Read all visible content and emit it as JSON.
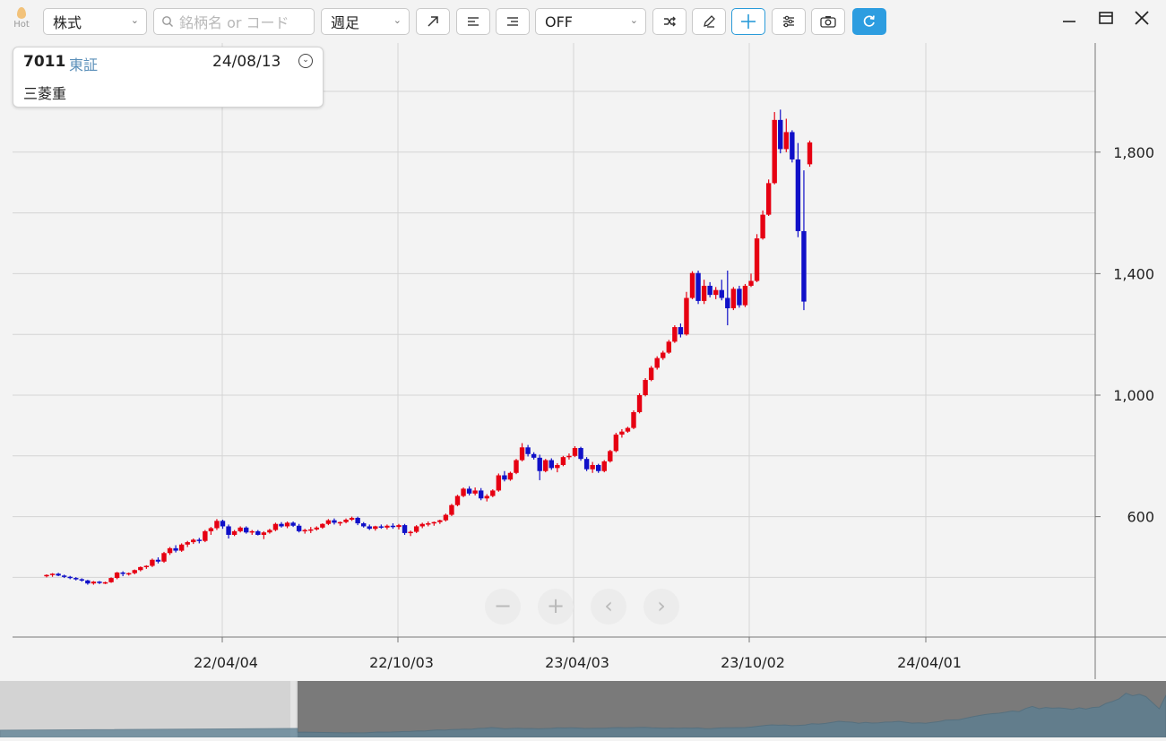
{
  "toolbar": {
    "hot_label": "Hot",
    "market_select": "株式",
    "search_placeholder": "銘柄名 or コード",
    "period_select": "週足",
    "indicator_select": "OFF"
  },
  "info_card": {
    "code": "7011",
    "exchange": "東証",
    "date": "24/08/13",
    "name": "三菱重"
  },
  "colors": {
    "up": "#e60012",
    "down": "#1010c8",
    "grid": "#d4d4d4",
    "accent": "#2d9de0"
  },
  "chart_data": {
    "type": "candlestick",
    "x_tick_labels": [
      "22/04/04",
      "22/10/03",
      "23/04/03",
      "23/10/02",
      "24/04/01"
    ],
    "y_tick_labels": [
      "600",
      "1,000",
      "1,400",
      "1,800"
    ],
    "y_ticks": [
      600,
      1000,
      1400,
      1800
    ],
    "ylim": [
      200,
      2000
    ],
    "grid": true,
    "x_axis_origin": "2021-11-08",
    "candles": [
      [
        0,
        404,
        410,
        400,
        408
      ],
      [
        1,
        408,
        414,
        402,
        412
      ],
      [
        2,
        412,
        415,
        404,
        406
      ],
      [
        3,
        406,
        409,
        398,
        402
      ],
      [
        4,
        402,
        405,
        394,
        398
      ],
      [
        5,
        398,
        401,
        390,
        394
      ],
      [
        6,
        394,
        397,
        386,
        390
      ],
      [
        7,
        390,
        392,
        376,
        380
      ],
      [
        8,
        380,
        388,
        376,
        386
      ],
      [
        9,
        386,
        388,
        378,
        382
      ],
      [
        10,
        382,
        386,
        378,
        384
      ],
      [
        11,
        384,
        400,
        382,
        398
      ],
      [
        12,
        398,
        418,
        394,
        416
      ],
      [
        13,
        416,
        420,
        404,
        412
      ],
      [
        14,
        412,
        416,
        406,
        414
      ],
      [
        15,
        414,
        426,
        410,
        424
      ],
      [
        16,
        424,
        436,
        420,
        434
      ],
      [
        17,
        434,
        440,
        428,
        438
      ],
      [
        18,
        438,
        462,
        434,
        458
      ],
      [
        19,
        458,
        466,
        446,
        452
      ],
      [
        20,
        452,
        484,
        448,
        480
      ],
      [
        21,
        480,
        500,
        474,
        496
      ],
      [
        22,
        496,
        506,
        482,
        488
      ],
      [
        23,
        488,
        512,
        484,
        508
      ],
      [
        24,
        508,
        520,
        500,
        516
      ],
      [
        25,
        516,
        528,
        510,
        524
      ],
      [
        26,
        524,
        530,
        512,
        520
      ],
      [
        27,
        520,
        556,
        516,
        552
      ],
      [
        28,
        552,
        566,
        540,
        562
      ],
      [
        29,
        562,
        592,
        556,
        586
      ],
      [
        30,
        586,
        590,
        560,
        568
      ],
      [
        31,
        568,
        574,
        528,
        540
      ],
      [
        32,
        540,
        556,
        536,
        552
      ],
      [
        33,
        552,
        568,
        548,
        564
      ],
      [
        34,
        564,
        568,
        544,
        548
      ],
      [
        35,
        548,
        556,
        540,
        552
      ],
      [
        36,
        552,
        556,
        538,
        540
      ],
      [
        37,
        540,
        552,
        526,
        548
      ],
      [
        38,
        548,
        560,
        544,
        556
      ],
      [
        39,
        556,
        580,
        552,
        576
      ],
      [
        40,
        576,
        582,
        564,
        568
      ],
      [
        41,
        568,
        584,
        562,
        580
      ],
      [
        42,
        580,
        584,
        566,
        570
      ],
      [
        43,
        570,
        576,
        548,
        552
      ],
      [
        44,
        552,
        560,
        544,
        556
      ],
      [
        45,
        556,
        566,
        546,
        558
      ],
      [
        46,
        558,
        568,
        554,
        564
      ],
      [
        47,
        564,
        578,
        560,
        576
      ],
      [
        48,
        576,
        592,
        572,
        588
      ],
      [
        49,
        588,
        594,
        574,
        580
      ],
      [
        50,
        580,
        584,
        570,
        582
      ],
      [
        51,
        582,
        594,
        578,
        590
      ],
      [
        52,
        590,
        600,
        586,
        596
      ],
      [
        53,
        596,
        600,
        572,
        578
      ],
      [
        54,
        578,
        582,
        564,
        568
      ],
      [
        55,
        568,
        574,
        556,
        560
      ],
      [
        56,
        560,
        570,
        554,
        568
      ],
      [
        57,
        568,
        574,
        560,
        564
      ],
      [
        58,
        564,
        574,
        558,
        570
      ],
      [
        59,
        570,
        578,
        560,
        566
      ],
      [
        60,
        566,
        576,
        558,
        572
      ],
      [
        61,
        572,
        576,
        540,
        546
      ],
      [
        62,
        546,
        554,
        536,
        550
      ],
      [
        63,
        550,
        572,
        546,
        568
      ],
      [
        64,
        568,
        580,
        562,
        576
      ],
      [
        65,
        576,
        584,
        568,
        578
      ],
      [
        66,
        578,
        584,
        570,
        582
      ],
      [
        67,
        582,
        590,
        576,
        588
      ],
      [
        68,
        588,
        610,
        584,
        606
      ],
      [
        69,
        606,
        642,
        602,
        638
      ],
      [
        70,
        638,
        672,
        634,
        668
      ],
      [
        71,
        668,
        696,
        664,
        692
      ],
      [
        72,
        692,
        700,
        670,
        676
      ],
      [
        73,
        676,
        696,
        670,
        686
      ],
      [
        74,
        686,
        694,
        654,
        660
      ],
      [
        75,
        660,
        674,
        650,
        668
      ],
      [
        76,
        668,
        690,
        664,
        686
      ],
      [
        77,
        686,
        742,
        682,
        736
      ],
      [
        78,
        736,
        750,
        716,
        722
      ],
      [
        79,
        722,
        748,
        718,
        744
      ],
      [
        80,
        744,
        790,
        740,
        786
      ],
      [
        81,
        786,
        842,
        782,
        828
      ],
      [
        82,
        828,
        836,
        798,
        806
      ],
      [
        83,
        806,
        812,
        788,
        794
      ],
      [
        84,
        794,
        804,
        720,
        750
      ],
      [
        85,
        750,
        790,
        746,
        786
      ],
      [
        86,
        786,
        792,
        754,
        760
      ],
      [
        87,
        760,
        776,
        746,
        770
      ],
      [
        88,
        770,
        800,
        766,
        796
      ],
      [
        89,
        796,
        808,
        788,
        800
      ],
      [
        90,
        800,
        832,
        796,
        826
      ],
      [
        91,
        826,
        830,
        784,
        790
      ],
      [
        92,
        790,
        796,
        750,
        756
      ],
      [
        93,
        756,
        780,
        744,
        770
      ],
      [
        94,
        770,
        774,
        744,
        750
      ],
      [
        95,
        750,
        786,
        746,
        782
      ],
      [
        96,
        782,
        820,
        778,
        816
      ],
      [
        97,
        816,
        876,
        812,
        870
      ],
      [
        98,
        870,
        888,
        860,
        880
      ],
      [
        99,
        880,
        896,
        876,
        892
      ],
      [
        100,
        892,
        950,
        888,
        944
      ],
      [
        101,
        944,
        1006,
        940,
        1000
      ],
      [
        102,
        1000,
        1056,
        996,
        1050
      ],
      [
        103,
        1050,
        1096,
        1046,
        1090
      ],
      [
        104,
        1090,
        1128,
        1084,
        1122
      ],
      [
        105,
        1122,
        1146,
        1116,
        1140
      ],
      [
        106,
        1140,
        1182,
        1136,
        1176
      ],
      [
        107,
        1176,
        1230,
        1172,
        1224
      ],
      [
        108,
        1224,
        1236,
        1190,
        1200
      ],
      [
        109,
        1200,
        1340,
        1196,
        1320
      ],
      [
        110,
        1320,
        1408,
        1316,
        1402
      ],
      [
        111,
        1402,
        1410,
        1300,
        1310
      ],
      [
        112,
        1310,
        1380,
        1300,
        1360
      ],
      [
        113,
        1360,
        1372,
        1322,
        1330
      ],
      [
        114,
        1330,
        1356,
        1316,
        1346
      ],
      [
        115,
        1346,
        1380,
        1312,
        1320
      ],
      [
        116,
        1320,
        1410,
        1230,
        1286
      ],
      [
        117,
        1286,
        1356,
        1280,
        1350
      ],
      [
        118,
        1350,
        1360,
        1288,
        1296
      ],
      [
        119,
        1296,
        1366,
        1290,
        1360
      ],
      [
        120,
        1360,
        1400,
        1356,
        1376
      ],
      [
        121,
        1376,
        1530,
        1372,
        1516
      ],
      [
        122,
        1516,
        1608,
        1512,
        1594
      ],
      [
        123,
        1594,
        1710,
        1590,
        1698
      ],
      [
        124,
        1698,
        1932,
        1694,
        1906
      ],
      [
        125,
        1906,
        1940,
        1796,
        1810
      ],
      [
        126,
        1810,
        1910,
        1800,
        1866
      ],
      [
        127,
        1866,
        1872,
        1766,
        1776
      ],
      [
        128,
        1776,
        1830,
        1520,
        1540
      ],
      [
        129,
        1540,
        1740,
        1280,
        1308
      ],
      [
        130,
        1760,
        1838,
        1752,
        1832
      ]
    ]
  }
}
